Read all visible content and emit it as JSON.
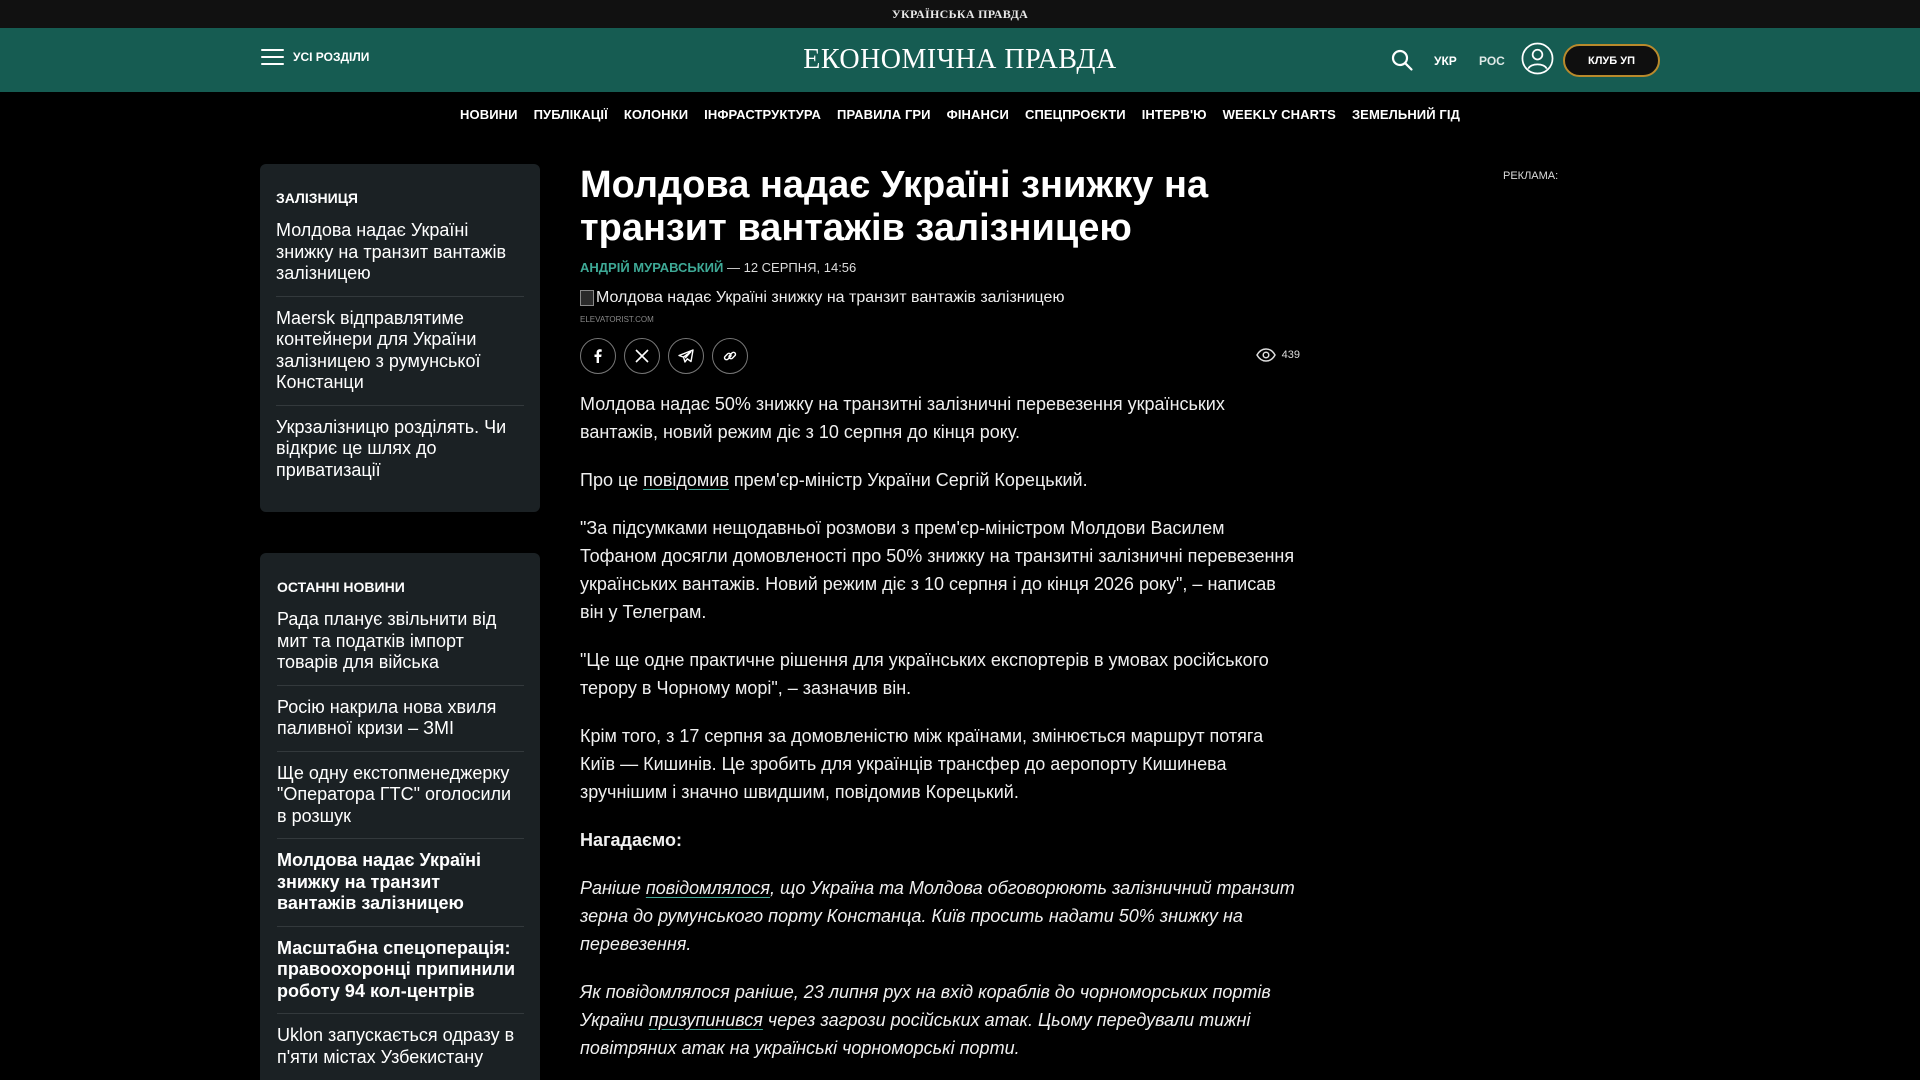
{
  "top_strip": {
    "title": "УКРАЇНСЬКА ПРАВДА"
  },
  "header": {
    "menu_label": "УСІ РОЗДІЛИ",
    "logo": "ЕКОНОМІЧНА ПРАВДА",
    "lang_ukr": "УКР",
    "lang_ros": "РОС",
    "club_label": "КЛУБ УП",
    "icons": [
      "search-icon",
      "user-icon",
      "menu-icon"
    ],
    "accent_color": "#165c52",
    "club_border_color": "#b98a2c"
  },
  "nav": {
    "items": [
      "НОВИНИ",
      "ПУБЛІКАЦІЇ",
      "КОЛОНКИ",
      "ІНФРАСТРУКТУРА",
      "ПРАВИЛА ГРИ",
      "ФІНАНСИ",
      "СПЕЦПРОЄКТИ",
      "ІНТЕРВ'Ю",
      "WEEKLY CHARTS",
      "ЗЕМЕЛЬНИЙ ГІД"
    ]
  },
  "sidebar": {
    "rail_title": "ЗАЛІЗНИЦЯ",
    "rail_items": [
      "Молдова надає Україні знижку на транзит вантажів залізницею",
      "Maersk відправлятиме контейнери для України залізницею з румунської Констанци",
      "Укрзалізницю розділять. Чи відкриє це шлях до приватизації"
    ],
    "latest_title": "ОСТАННІ НОВИНИ",
    "latest_items": [
      "Рада планує звільнити від мит та податків імпорт товарів для війська",
      "Росію накрила нова хвиля паливної кризи – ЗМІ",
      "Ще одну екстопменеджерку \"Оператора ГТС\" оголосили в розшук",
      "Молдова надає Україні знижку на транзит вантажів залізницею",
      "Масштабна спецоперація: правоохоронці припинили роботу 94 кол-центрів",
      "Uklon запускається одразу в п'яти містах Узбекистану"
    ]
  },
  "article": {
    "headline": "Молдова надає Україні знижку на транзит вантажів залізницею",
    "author": "АНДРІЙ МУРАВСЬКИЙ",
    "separator": " — ",
    "date": "12 СЕРПНЯ, 14:56",
    "image_alt": "Молдова надає Україні знижку на транзит вантажів залізницею",
    "image_source": "ELEVATORIST.COM",
    "share_icons": [
      "facebook-icon",
      "x-icon",
      "telegram-icon",
      "link-icon"
    ],
    "views": "439",
    "p1": "Молдова надає 50% знижку на транзитні залізничні перевезення українських вантажів, новий режим діє з 10 серпня до кінця року.",
    "p2_before": "Про це ",
    "p2_link": "повідомив",
    "p2_after": " прем'єр-міністр України Сергій Корецький.",
    "p3": "\"За підсумками нещодавньої розмови з прем'єр-міністром Молдови Василем Тофаном досягли домовленості про 50% знижку на транзитні залізничні перевезення українських вантажів. Новий режим діє з 10 серпня і до кінця 2026 року\", – написав він у Телеграм.",
    "p4": "\"Це ще одне практичне рішення для українських експортерів в умовах російського терору в Чорному морі\", – зазначив він.",
    "p5": "Крім того, з 17 серпня за домовленістю між країнами, змінюється маршрут потяга Київ — Кишинів. Це зробить для українців трансфер до аеропорту Кишинева зручнішим і значно швидшим, повідомив Корецький.",
    "reminder": "Нагадаємо:",
    "p6_before": "Раніше ",
    "p6_link": "повідомлялося",
    "p6_after": ", що Україна та Молдова обговорюють залізничний транзит зерна до румунського порту Констанца. Київ просить надати 50% знижку на перевезення.",
    "p7_before": "Як повідомлялося раніше, 23 липня рух на вхід кораблів до чорноморських портів України ",
    "p7_link": "призупинився",
    "p7_after": " через загрози російських атак. Цьому передували тижні повітряних атак на українські чорноморські порти."
  },
  "ad": {
    "label": "РЕКЛАМА:"
  }
}
